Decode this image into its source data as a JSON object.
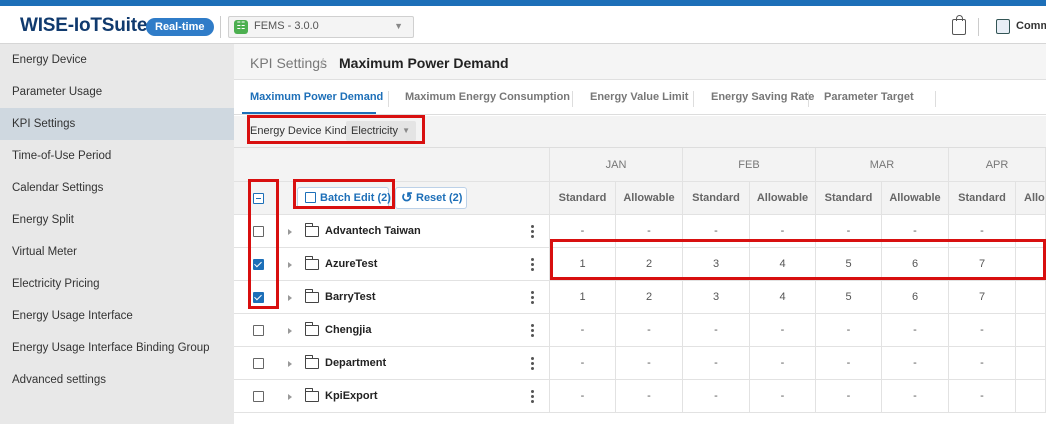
{
  "header": {
    "brand": "WISE-IoTSuite",
    "badge": "Real-time",
    "app_selector": "FEMS - 3.0.0",
    "community_label": "Comm"
  },
  "sidebar": {
    "items": [
      {
        "label": "Energy Device"
      },
      {
        "label": "Parameter Usage"
      },
      {
        "label": "KPI Settings",
        "active": true
      },
      {
        "label": "Time-of-Use Period"
      },
      {
        "label": "Calendar Settings"
      },
      {
        "label": "Energy Split"
      },
      {
        "label": "Virtual Meter"
      },
      {
        "label": "Electricity Pricing"
      },
      {
        "label": "Energy Usage Interface"
      },
      {
        "label": "Energy Usage Interface Binding Group"
      },
      {
        "label": "Advanced settings"
      }
    ]
  },
  "breadcrumb": {
    "parent": "KPI Settings",
    "separator": "/",
    "current": "Maximum Power Demand"
  },
  "tabs": [
    {
      "label": "Maximum Power Demand",
      "active": true
    },
    {
      "label": "Maximum Energy Consumption"
    },
    {
      "label": "Energy Value Limit"
    },
    {
      "label": "Energy Saving Rate"
    },
    {
      "label": "Parameter Target"
    }
  ],
  "filter": {
    "label": "Energy Device Kind",
    "value": "Electricity"
  },
  "toolbar": {
    "batch_edit": "Batch Edit (2)",
    "reset": "Reset (2)"
  },
  "table": {
    "months": [
      "JAN",
      "FEB",
      "MAR",
      "APR"
    ],
    "sub_headers": [
      "Standard",
      "Allowable",
      "Standard",
      "Allowable",
      "Standard",
      "Allowable",
      "Standard",
      "Allo"
    ],
    "rows": [
      {
        "name": "Advantech Taiwan",
        "checked": false,
        "values": [
          "-",
          "-",
          "-",
          "-",
          "-",
          "-",
          "-"
        ]
      },
      {
        "name": "AzureTest",
        "checked": true,
        "values": [
          "1",
          "2",
          "3",
          "4",
          "5",
          "6",
          "7"
        ]
      },
      {
        "name": "BarryTest",
        "checked": true,
        "values": [
          "1",
          "2",
          "3",
          "4",
          "5",
          "6",
          "7"
        ]
      },
      {
        "name": "Chengjia",
        "checked": false,
        "values": [
          "-",
          "-",
          "-",
          "-",
          "-",
          "-",
          "-"
        ]
      },
      {
        "name": "Department",
        "checked": false,
        "values": [
          "-",
          "-",
          "-",
          "-",
          "-",
          "-",
          "-"
        ]
      },
      {
        "name": "KpiExport",
        "checked": false,
        "values": [
          "-",
          "-",
          "-",
          "-",
          "-",
          "-",
          "-"
        ]
      }
    ]
  },
  "colors": {
    "accent": "#1d6fb8",
    "highlight": "#d80f0f",
    "brand": "#103a6e"
  }
}
